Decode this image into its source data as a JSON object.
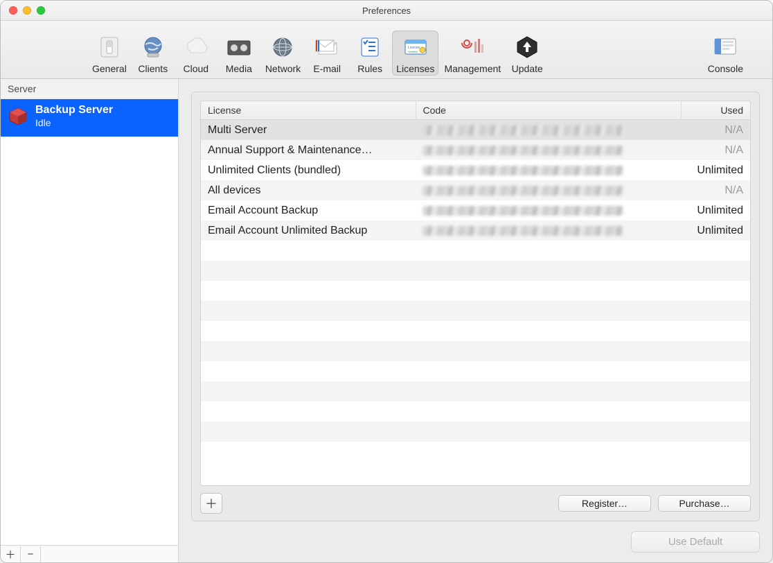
{
  "window": {
    "title": "Preferences"
  },
  "toolbar": {
    "items": [
      {
        "id": "general",
        "label": "General"
      },
      {
        "id": "clients",
        "label": "Clients"
      },
      {
        "id": "cloud",
        "label": "Cloud"
      },
      {
        "id": "media",
        "label": "Media"
      },
      {
        "id": "network",
        "label": "Network"
      },
      {
        "id": "email",
        "label": "E-mail"
      },
      {
        "id": "rules",
        "label": "Rules"
      },
      {
        "id": "licenses",
        "label": "Licenses",
        "selected": true
      },
      {
        "id": "management",
        "label": "Management"
      },
      {
        "id": "update",
        "label": "Update"
      },
      {
        "id": "console",
        "label": "Console"
      }
    ]
  },
  "sidebar": {
    "header": "Server",
    "servers": [
      {
        "name": "Backup Server",
        "status": "Idle",
        "selected": true
      }
    ]
  },
  "licenses": {
    "columns": {
      "license": "License",
      "code": "Code",
      "used": "Used"
    },
    "rows": [
      {
        "license": "Multi Server",
        "code_redacted": true,
        "used": "N/A",
        "na": true,
        "selected": true
      },
      {
        "license": "Annual Support & Maintenance…",
        "code_redacted": true,
        "used": "N/A",
        "na": true
      },
      {
        "license": "Unlimited Clients (bundled)",
        "code_redacted": true,
        "used": "Unlimited",
        "na": false
      },
      {
        "license": "All devices",
        "code_redacted": true,
        "used": "N/A",
        "na": true
      },
      {
        "license": "Email Account Backup",
        "code_redacted": true,
        "used": "Unlimited",
        "na": false
      },
      {
        "license": "Email Account Unlimited Backup",
        "code_redacted": true,
        "used": "Unlimited",
        "na": false
      }
    ],
    "buttons": {
      "register": "Register…",
      "purchase": "Purchase…",
      "use_default": "Use Default"
    }
  }
}
